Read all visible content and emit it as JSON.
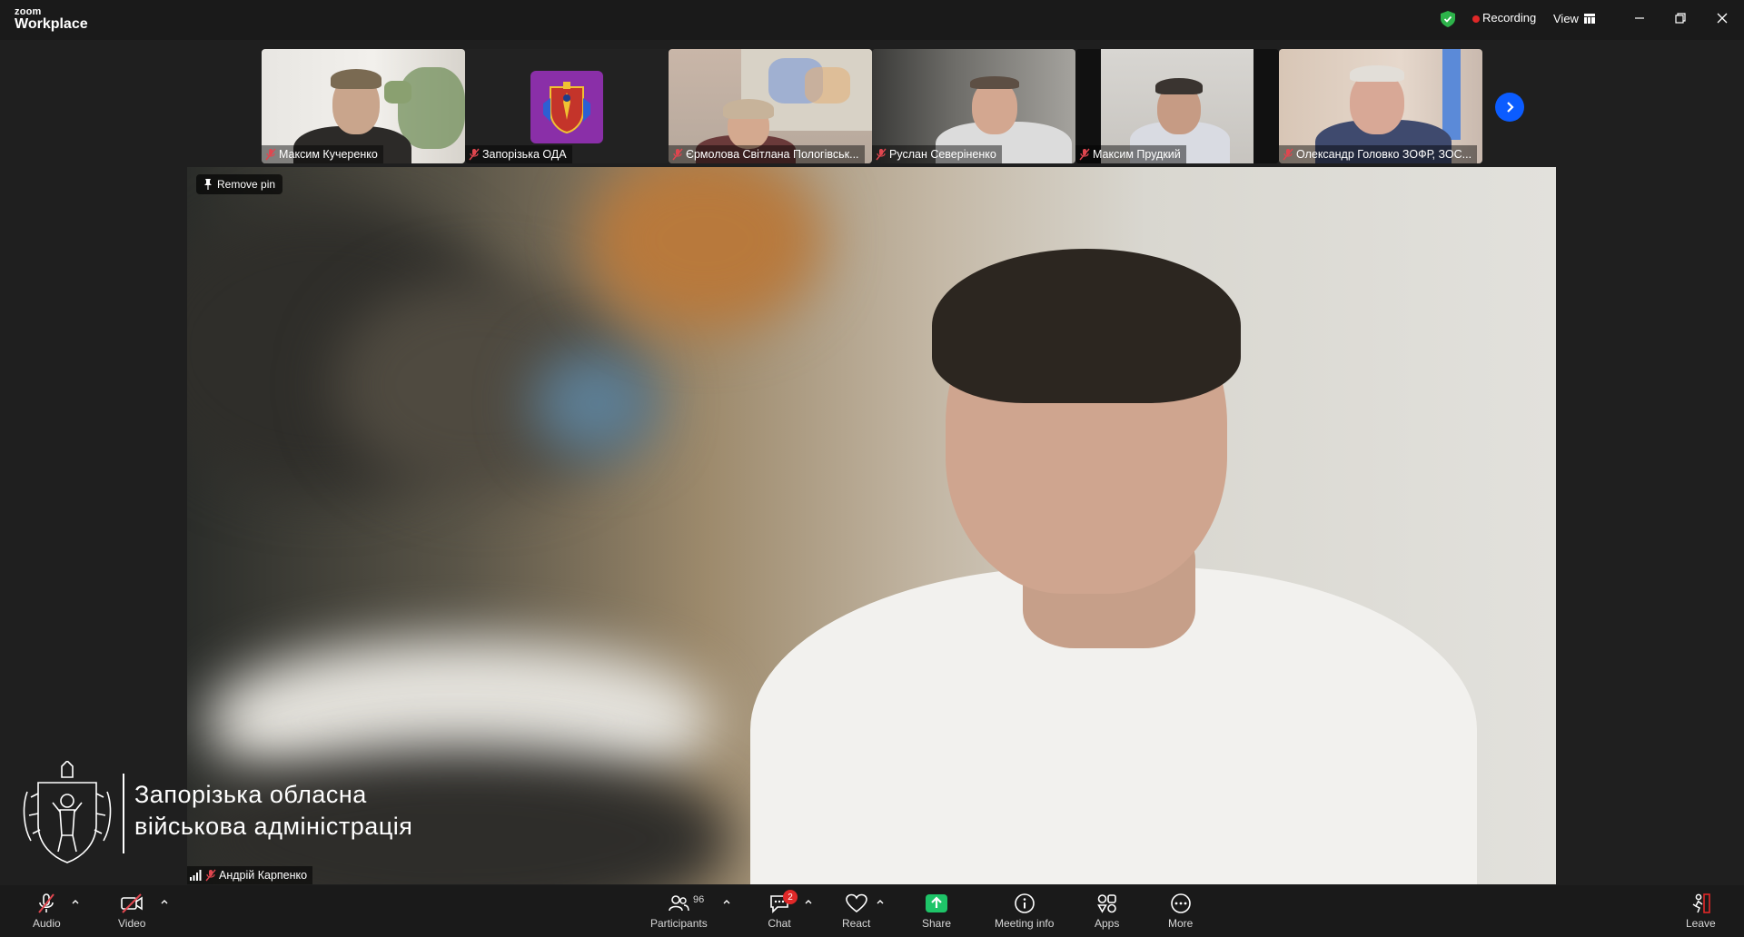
{
  "titlebar": {
    "logo_small": "zoom",
    "logo_big": "Workplace",
    "recording_label": "Recording",
    "view_label": "View"
  },
  "thumbnails": [
    {
      "name": "Максим Кучеренко"
    },
    {
      "name": "Запорізька ОДА"
    },
    {
      "name": "Єрмолова Світлана Пологівськ..."
    },
    {
      "name": "Руслан Северіненко"
    },
    {
      "name": "Максим Прудкий"
    },
    {
      "name": "Олександр Головко ЗОФР, ЗОС..."
    }
  ],
  "main": {
    "remove_pin_label": "Remove pin",
    "speaker_name": "Андрій Карпенко"
  },
  "org": {
    "line1": "Запорізька обласна",
    "line2": "військова адміністрація"
  },
  "toolbar": {
    "audio": "Audio",
    "video": "Video",
    "participants": "Participants",
    "participants_count": "96",
    "chat": "Chat",
    "chat_badge": "2",
    "react": "React",
    "share": "Share",
    "meeting_info": "Meeting info",
    "apps": "Apps",
    "more": "More",
    "leave": "Leave"
  },
  "colors": {
    "accent": "#0b5cff",
    "recording": "#e02828",
    "share": "#1ec468",
    "shield": "#2db34a"
  }
}
